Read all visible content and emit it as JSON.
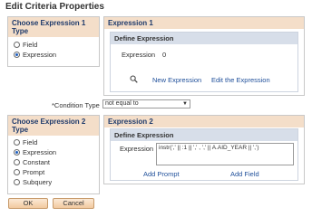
{
  "page": {
    "title": "Edit Criteria Properties"
  },
  "expr1_type": {
    "header": "Choose Expression 1 Type",
    "options": [
      {
        "label": "Field",
        "checked": false
      },
      {
        "label": "Expression",
        "checked": true
      }
    ]
  },
  "expr1": {
    "header": "Expression 1",
    "define_header": "Define Expression",
    "expression_label": "Expression",
    "expression_value": "0",
    "new_expression_link": "New Expression",
    "edit_expression_link": "Edit the Expression",
    "search_icon": "search-icon"
  },
  "condition": {
    "label": "*Condition Type",
    "value": "not equal to"
  },
  "expr2_type": {
    "header": "Choose Expression 2 Type",
    "options": [
      {
        "label": "Field",
        "checked": false
      },
      {
        "label": "Expression",
        "checked": true
      },
      {
        "label": "Constant",
        "checked": false
      },
      {
        "label": "Prompt",
        "checked": false
      },
      {
        "label": "Subquery",
        "checked": false
      }
    ]
  },
  "expr2": {
    "header": "Expression 2",
    "define_header": "Define Expression",
    "expression_label": "Expression",
    "expression_value": "instr(',' || :1 || ',' , ',' || A.AID_YEAR || ',')",
    "add_prompt_link": "Add Prompt",
    "add_field_link": "Add Field"
  },
  "buttons": {
    "ok": "OK",
    "cancel": "Cancel"
  },
  "colors": {
    "group_header_bg": "#f4dec9",
    "group_header_text": "#1e3a6b",
    "inner_header_bg": "#d7dee9",
    "link": "#1f4f9a"
  }
}
